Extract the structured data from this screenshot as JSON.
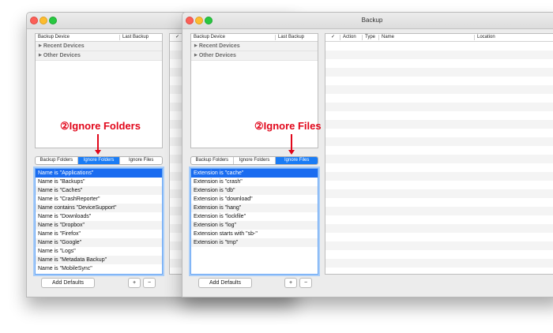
{
  "left_window": {
    "devices_header": {
      "col1": "Backup Device",
      "col2": "Last Backup"
    },
    "check_header": "✓",
    "groups": [
      "Recent Devices",
      "Other Devices"
    ],
    "tabs": [
      {
        "label": "Backup Folders",
        "selected": false
      },
      {
        "label": "Ignore Folders",
        "selected": true
      },
      {
        "label": "Ignore Files",
        "selected": false
      }
    ],
    "annotation": "②Ignore Folders",
    "items": [
      "Name is \"Applications\"",
      "Name is \"Backups\"",
      "Name is \"Caches\"",
      "Name is \"CrashReporter\"",
      "Name contains \"DeviceSupport\"",
      "Name is \"Downloads\"",
      "Name is \"Dropbox\"",
      "Name is \"Firefox\"",
      "Name is \"Google\"",
      "Name is \"Logs\"",
      "Name is \"Metadata Backup\"",
      "Name is \"MobileSync\""
    ],
    "add_defaults": "Add Defaults",
    "plus": "+",
    "minus": "−"
  },
  "right_window": {
    "title": "Backup",
    "devices_header": {
      "col1": "Backup Device",
      "col2": "Last Backup"
    },
    "groups": [
      "Recent Devices",
      "Other Devices"
    ],
    "tabs": [
      {
        "label": "Backup Folders",
        "selected": false
      },
      {
        "label": "Ignore Folders",
        "selected": false
      },
      {
        "label": "Ignore Files",
        "selected": true
      }
    ],
    "annotation": "②Ignore Files",
    "items": [
      "Extension is \"cache\"",
      "Extension is \"crash\"",
      "Extension is \"db\"",
      "Extension is \"download\"",
      "Extension is \"hang\"",
      "Extension is \"lockfile\"",
      "Extension is \"log\"",
      "Extension starts with \"sb-\"",
      "Extension is \"tmp\""
    ],
    "add_defaults": "Add Defaults",
    "plus": "+",
    "minus": "−",
    "table_header": {
      "check": "✓",
      "action": "Action",
      "type": "Type",
      "name": "Name",
      "location": "Location"
    }
  }
}
